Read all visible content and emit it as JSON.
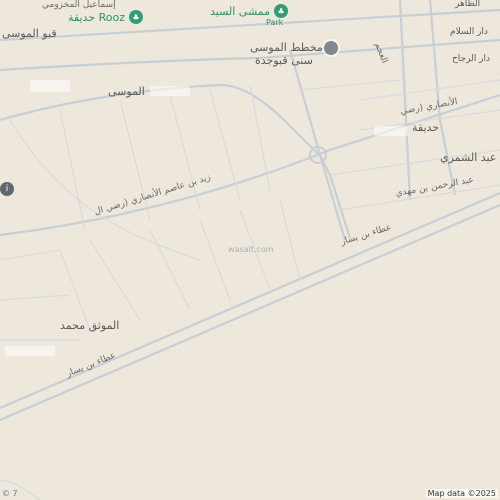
{
  "map": {
    "labels": {
      "rooz_park": "حديقة Rooz",
      "mamsha": "ممشى السيد",
      "mamsha_sub": "Park",
      "plan_line1": "مخطط الموسى",
      "plan_line2": "سنى قبوجدة",
      "qabu_moosa": "قبو الموسى",
      "moosa": "الموسى",
      "hadiqa_right": "حديقة",
      "asim_right": "الأنصاري (رضي",
      "abd_shamri": "عبد الشمري",
      "abd_mahdi": "عبد الرحمن بن مهدي",
      "dar_salam": "دار السلام",
      "dar_rajjah": "دار الرجاح",
      "top_right": "الظاهر",
      "al_ajam": "العجم",
      "mouwafaq": "الموثق محمد",
      "zaid_asim": "زيد بن عاصم الأنصاري (رضي ال",
      "ata_1": "عطاء بن بسار",
      "ata_2": "عطاء بن يسار",
      "makhzoomi": "إسماعيل المخزومي",
      "watermark": "wasalt.com",
      "attribution": "Map data ©2025",
      "logo": "© 7"
    },
    "colors": {
      "land": "#eee7dc",
      "road": "#d0d6d9",
      "road_outline": "#b8c1c6",
      "park_green": "#2f9d78",
      "marker": "#808890"
    },
    "icons": [
      "tree-icon",
      "location-dot-icon",
      "info-icon"
    ]
  }
}
